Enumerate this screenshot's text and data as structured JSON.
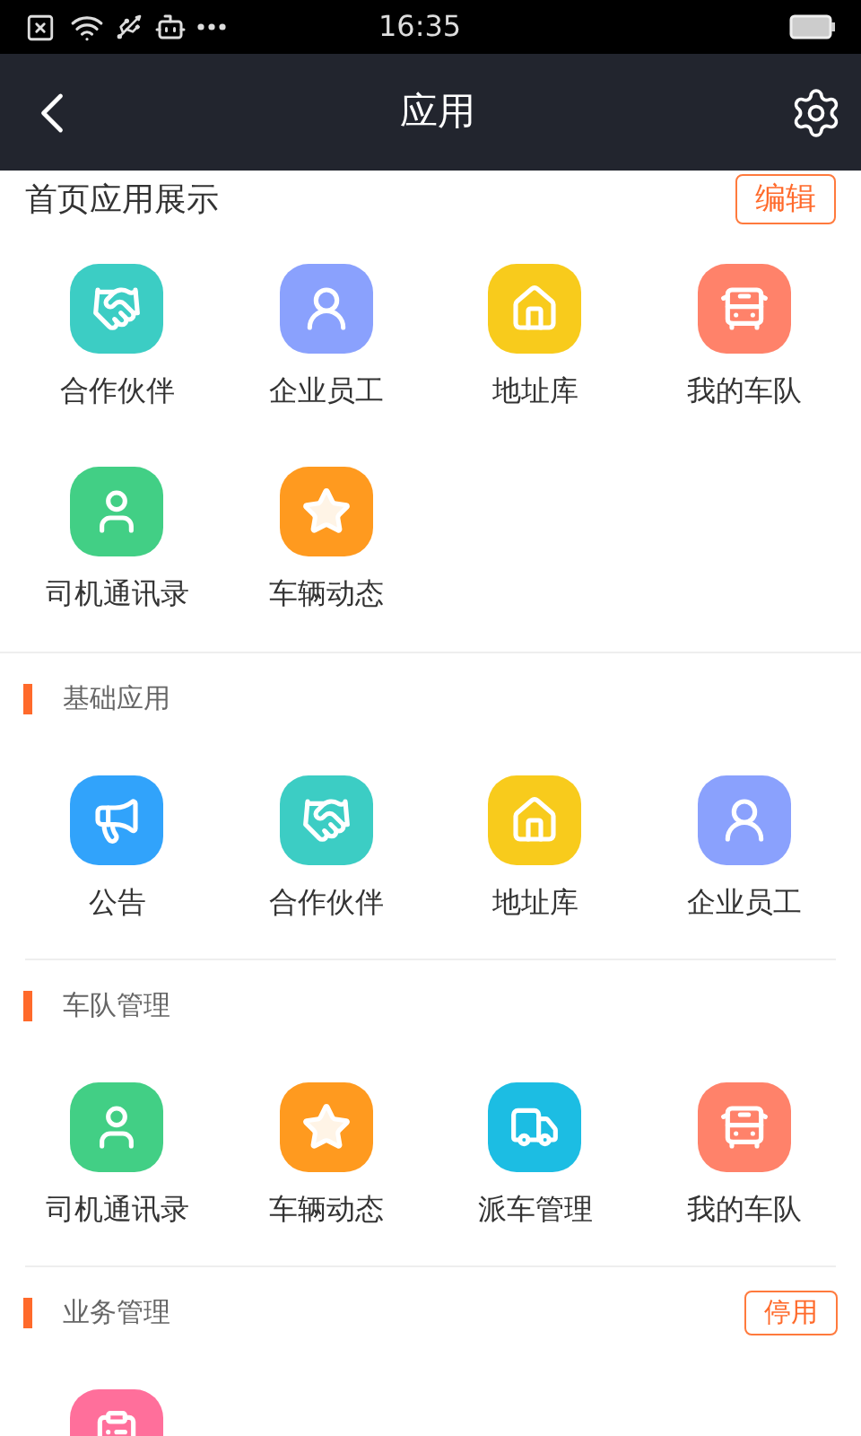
{
  "status_bar": {
    "time": "16:35"
  },
  "nav": {
    "title": "应用"
  },
  "home_apps": {
    "title": "首页应用展示",
    "edit_button": "编辑",
    "items": [
      {
        "label": "合作伙伴",
        "kind": "handshake",
        "color": "#3ccdc4"
      },
      {
        "label": "企业员工",
        "kind": "person",
        "color": "#8aa1fd"
      },
      {
        "label": "地址库",
        "kind": "house",
        "color": "#f8cb1c"
      },
      {
        "label": "我的车队",
        "kind": "bus",
        "color": "#ff826a"
      },
      {
        "label": "司机通讯录",
        "kind": "driver",
        "color": "#42cf85"
      },
      {
        "label": "车辆动态",
        "kind": "star",
        "color": "#ff9a1f"
      }
    ]
  },
  "sections": [
    {
      "title": "基础应用",
      "items": [
        {
          "label": "公告",
          "kind": "megaphone",
          "color": "#31a3fb"
        },
        {
          "label": "合作伙伴",
          "kind": "handshake",
          "color": "#3ccdc4"
        },
        {
          "label": "地址库",
          "kind": "house",
          "color": "#f8cb1c"
        },
        {
          "label": "企业员工",
          "kind": "person",
          "color": "#8aa1fd"
        }
      ]
    },
    {
      "title": "车队管理",
      "items": [
        {
          "label": "司机通讯录",
          "kind": "driver",
          "color": "#42cf85"
        },
        {
          "label": "车辆动态",
          "kind": "star",
          "color": "#ff9a1f"
        },
        {
          "label": "派车管理",
          "kind": "dispatch",
          "color": "#1cbde3"
        },
        {
          "label": "我的车队",
          "kind": "bus",
          "color": "#ff826a"
        }
      ]
    },
    {
      "title": "业务管理",
      "action": "停用",
      "items": [
        {
          "kind": "clipboard",
          "color": "#ff6f9b"
        }
      ]
    }
  ]
}
